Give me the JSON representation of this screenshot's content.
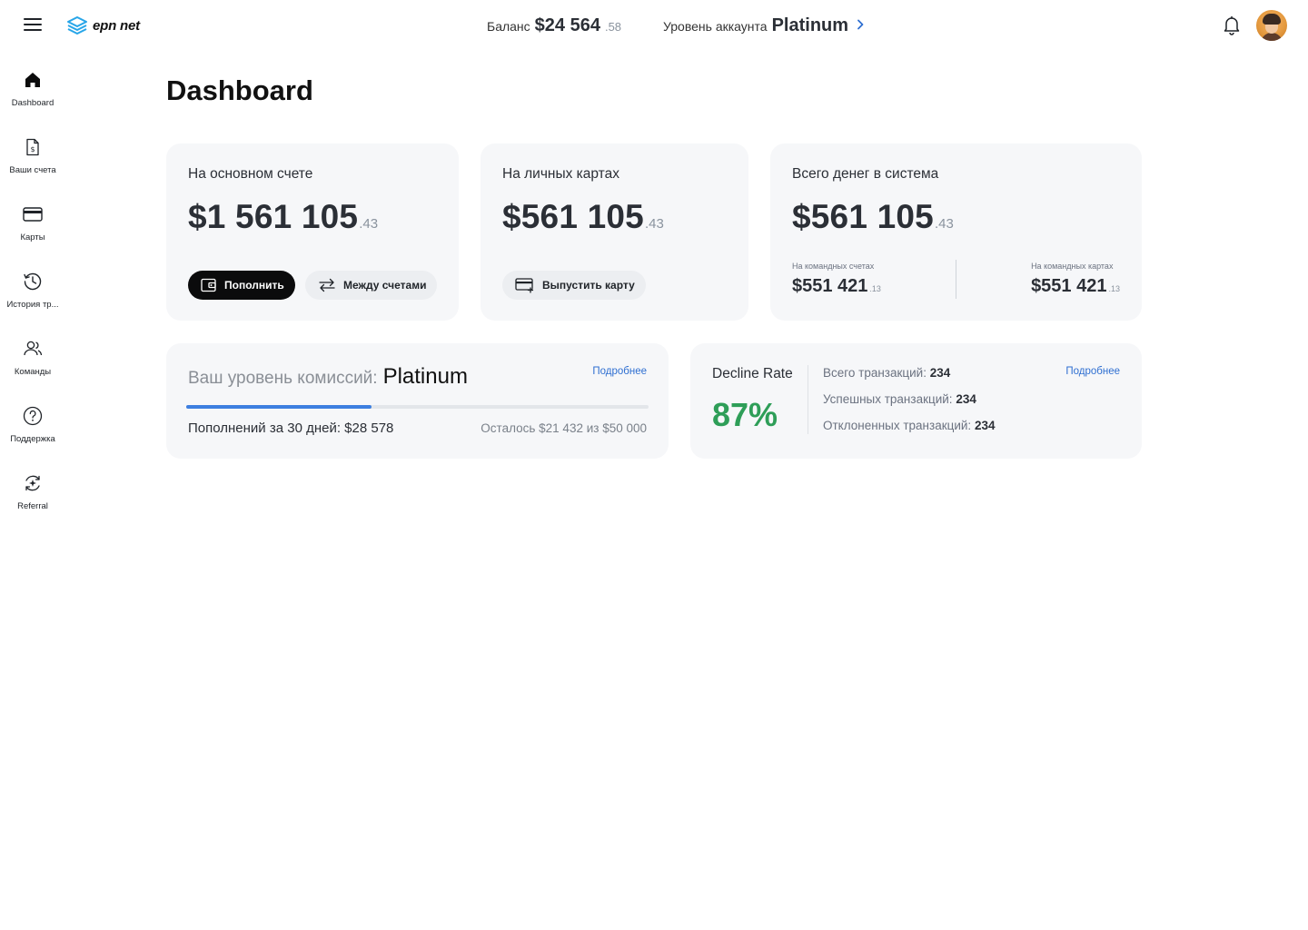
{
  "app": {
    "logo_text": "epn net"
  },
  "header": {
    "balance_label": "Баланс",
    "balance_main": "$24 564",
    "balance_cents": ".58",
    "level_label": "Уровень аккаунта",
    "level_value": "Platinum"
  },
  "sidebar": {
    "items": [
      {
        "label": "Dashboard",
        "icon": "home-icon",
        "active": true
      },
      {
        "label": "Ваши счета",
        "icon": "invoice-icon"
      },
      {
        "label": "Карты",
        "icon": "card-icon"
      },
      {
        "label": "История тр...",
        "icon": "history-icon"
      },
      {
        "label": "Команды",
        "icon": "team-icon"
      },
      {
        "label": "Поддержка",
        "icon": "help-icon"
      },
      {
        "label": "Referral",
        "icon": "referral-icon"
      }
    ]
  },
  "page": {
    "title": "Dashboard"
  },
  "cards": {
    "main_account": {
      "title": "На основном счете",
      "amount": "$1 561 105",
      "cents": ".43",
      "topup_label": "Пополнить",
      "transfer_label": "Между счетами"
    },
    "personal_cards": {
      "title": "На личных картах",
      "amount": "$561 105",
      "cents": ".43",
      "issue_label": "Выпустить карту"
    },
    "total": {
      "title": "Всего денег в система",
      "amount": "$561 105",
      "cents": ".43",
      "team_accounts_label": "На командных счетах",
      "team_accounts_amount": "$551 421",
      "team_accounts_cents": ".13",
      "team_cards_label": "На командных картах",
      "team_cards_amount": "$551 421",
      "team_cards_cents": ".13"
    }
  },
  "commission": {
    "label": "Ваш уровень комиссий:",
    "value": "Platinum",
    "more_link": "Подробнее",
    "progress_fraction": 0.4,
    "topups_text": "Пополнений за 30 дней: $28 578",
    "remaining_text": "Осталось $21 432 из $50 000"
  },
  "decline": {
    "title": "Decline Rate",
    "percent": "87%",
    "more_link": "Подробнее",
    "total_label": "Всего транзакций:",
    "total_value": "234",
    "success_label": "Успешных транзакций:",
    "success_value": "234",
    "declined_label": "Отклоненных транзакций:",
    "declined_value": "234"
  },
  "colors": {
    "accent_blue": "#3d7fe0",
    "success_green": "#2e9e58",
    "card_bg": "#f6f7f9",
    "dark_button": "#0b0b0c"
  }
}
